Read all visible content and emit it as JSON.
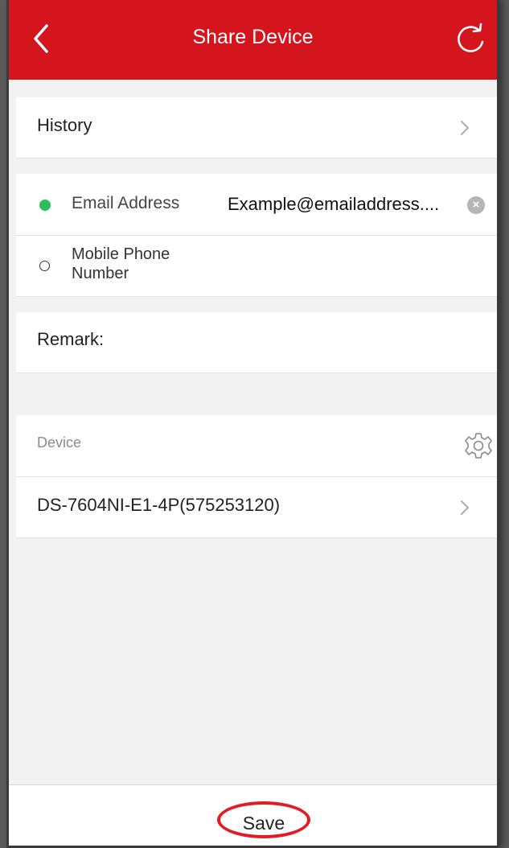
{
  "header": {
    "title": "Share Device",
    "background": "#d4151e",
    "back_icon": "chevron-left-icon",
    "refresh_icon": "refresh-icon"
  },
  "history": {
    "label": "History"
  },
  "share_target": {
    "email": {
      "label": "Email Address",
      "value": "Example@emailaddress....",
      "selected": true
    },
    "phone": {
      "label_line1": "Mobile Phone",
      "label_line2": "Number",
      "selected": false
    }
  },
  "remark": {
    "label": "Remark:"
  },
  "device_section": {
    "label": "Device",
    "settings_icon": "gear-icon",
    "device_name": "DS-7604NI-E1-4P(575253120)"
  },
  "footer": {
    "save_label": "Save",
    "highlight_color": "#e31b23"
  }
}
